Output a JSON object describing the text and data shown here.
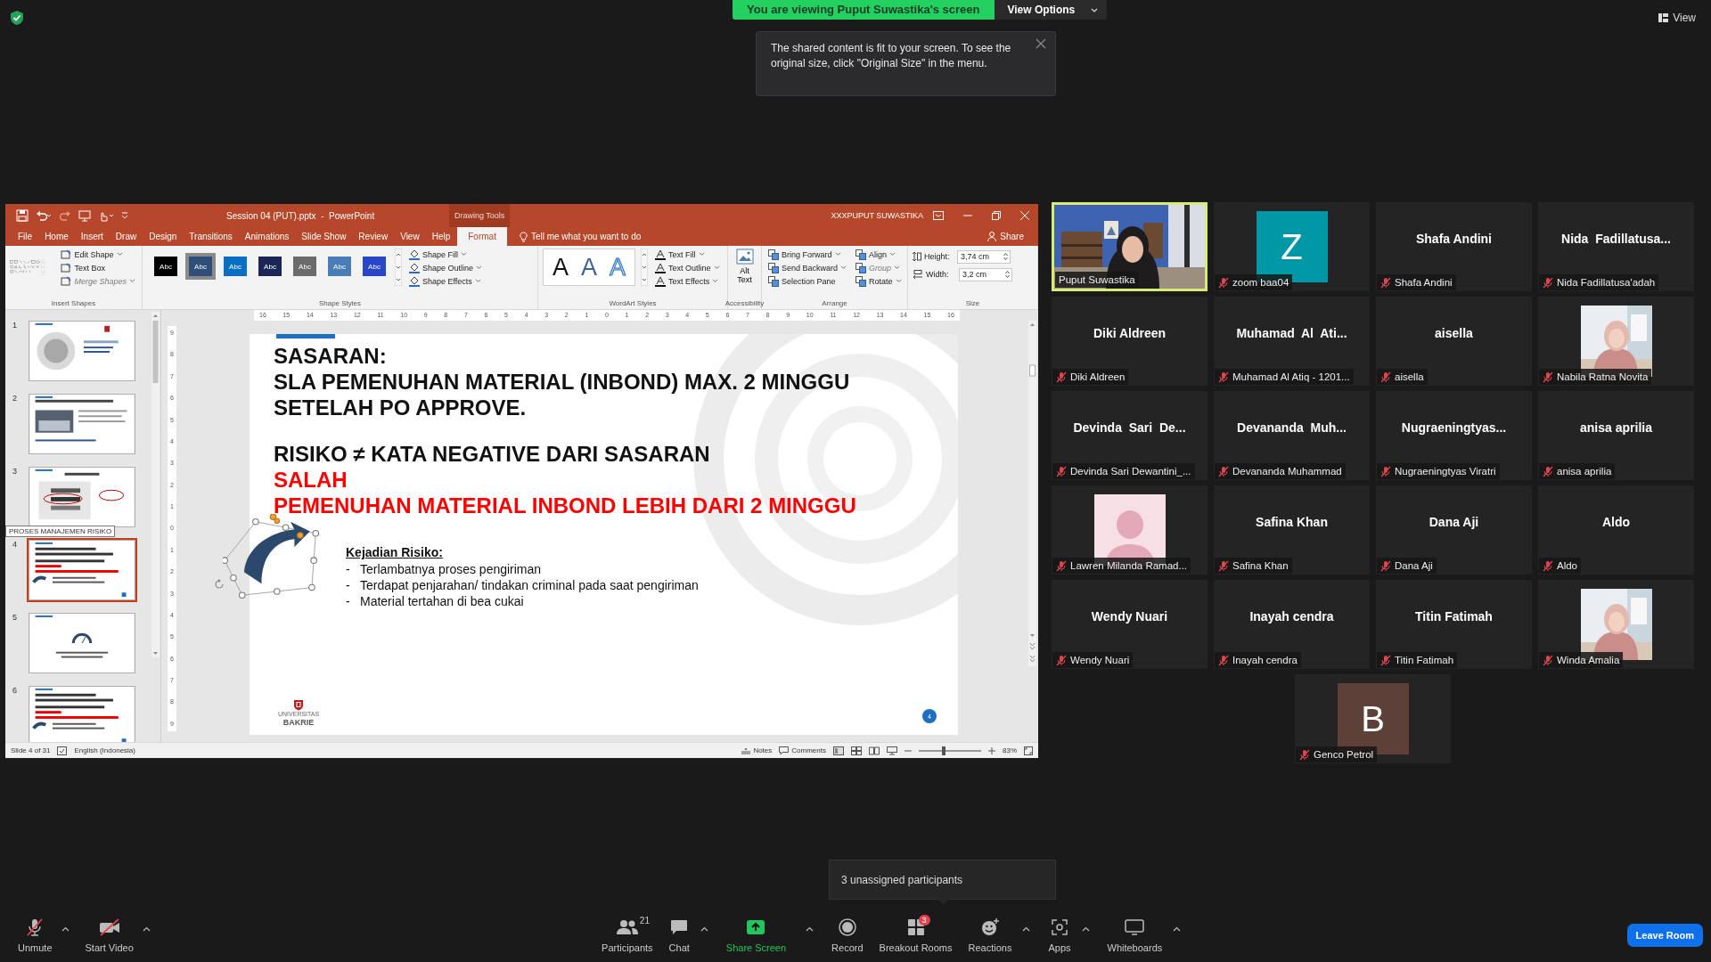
{
  "top_bar": {
    "banner": "You are viewing Puput Suwastika's screen",
    "view_options": "View Options",
    "view_button": "View"
  },
  "notice": "The shared content is fit to your screen. To see the original size, click \"Original Size\" in the menu.",
  "powerpoint": {
    "title": "Session 04 (PUT).pptx  -  PowerPoint",
    "context_label": "Drawing Tools",
    "user": "XXXPUPUT SUWASTIKA",
    "tabs": [
      {
        "label": "File",
        "selected": false
      },
      {
        "label": "Home",
        "selected": false
      },
      {
        "label": "Insert",
        "selected": false
      },
      {
        "label": "Draw",
        "selected": false
      },
      {
        "label": "Design",
        "selected": false
      },
      {
        "label": "Transitions",
        "selected": false
      },
      {
        "label": "Animations",
        "selected": false
      },
      {
        "label": "Slide Show",
        "selected": false
      },
      {
        "label": "Review",
        "selected": false
      },
      {
        "label": "View",
        "selected": false
      },
      {
        "label": "Help",
        "selected": false
      },
      {
        "label": "Format",
        "selected": true
      }
    ],
    "tell_me": "Tell me what you want to do",
    "share": "Share",
    "ribbon": [
      {
        "kind": "insert_shapes",
        "label": "Insert Shapes",
        "commands": [
          {
            "label": "Edit Shape",
            "dropdown": true,
            "disabled": false
          },
          {
            "label": "Text Box",
            "dropdown": false,
            "disabled": false
          },
          {
            "label": "Merge Shapes",
            "dropdown": true,
            "disabled": true
          }
        ]
      },
      {
        "kind": "shape_styles",
        "label": "Shape Styles",
        "styles": [
          {
            "label": "Abc",
            "color": "#000000",
            "selected": false
          },
          {
            "label": "Abc",
            "color": "#2f4e78",
            "selected": true
          },
          {
            "label": "Abc",
            "color": "#0a6fc2",
            "selected": false
          },
          {
            "label": "Abc",
            "color": "#1c2656",
            "selected": false
          },
          {
            "label": "Abc",
            "color": "#6b6b6b",
            "selected": false
          },
          {
            "label": "Abc",
            "color": "#4a7db5",
            "selected": false
          },
          {
            "label": "Abc",
            "color": "#2846c8",
            "selected": false
          }
        ],
        "commands": [
          {
            "label": "Shape Fill",
            "dropdown": true,
            "disabled": false
          },
          {
            "label": "Shape Outline",
            "dropdown": true,
            "disabled": false
          },
          {
            "label": "Shape Effects",
            "dropdown": true,
            "disabled": false
          }
        ]
      },
      {
        "kind": "wordart",
        "label": "WordArt Styles",
        "styles": [
          {
            "label": "A",
            "kind": "solid"
          },
          {
            "label": "A",
            "kind": "gradient"
          },
          {
            "label": "A",
            "kind": "outline"
          }
        ],
        "commands": [
          {
            "label": "Text Fill",
            "dropdown": true,
            "disabled": false
          },
          {
            "label": "Text Outline",
            "dropdown": true,
            "disabled": false
          },
          {
            "label": "Text Effects",
            "dropdown": true,
            "disabled": false
          }
        ]
      },
      {
        "kind": "alt_text",
        "label": "Accessibility",
        "button": "Alt Text"
      },
      {
        "kind": "arrange",
        "label": "Arrange",
        "commands": [
          {
            "label": "Bring Forward",
            "dropdown": true,
            "disabled": false
          },
          {
            "label": "Send Backward",
            "dropdown": true,
            "disabled": false
          },
          {
            "label": "Selection Pane",
            "dropdown": false,
            "disabled": false
          },
          {
            "label": "Align",
            "dropdown": true,
            "disabled": false
          },
          {
            "label": "Group",
            "dropdown": true,
            "disabled": true
          },
          {
            "label": "Rotate",
            "dropdown": true,
            "disabled": false
          }
        ]
      },
      {
        "kind": "size",
        "label": "Size",
        "fields": [
          {
            "label": "Height:",
            "value": "3,74 cm"
          },
          {
            "label": "Width:",
            "value": "3,2 cm"
          }
        ]
      }
    ],
    "ruler": {
      "horizontal": [
        "16",
        "15",
        "14",
        "13",
        "12",
        "11",
        "10",
        "9",
        "8",
        "7",
        "6",
        "5",
        "4",
        "3",
        "2",
        "1",
        "0",
        "1",
        "2",
        "3",
        "4",
        "5",
        "6",
        "7",
        "8",
        "9",
        "10",
        "11",
        "12",
        "13",
        "14",
        "15",
        "16"
      ],
      "vertical": [
        "9",
        "8",
        "7",
        "6",
        "5",
        "4",
        "3",
        "2",
        "1",
        "0",
        "1",
        "2",
        "3",
        "4",
        "5",
        "6",
        "7",
        "8",
        "9"
      ]
    },
    "thumbnails": [
      {
        "number": "1",
        "kind": "cover",
        "selected": false
      },
      {
        "number": "2",
        "selected": false
      },
      {
        "number": "3",
        "kind": "diagram",
        "selected": false
      },
      {
        "number": "4",
        "kind": "text",
        "selected": true
      },
      {
        "number": "5",
        "kind": "gauge",
        "selected": false
      },
      {
        "number": "6",
        "kind": "text",
        "selected": false
      }
    ],
    "thumbnail_tooltip": "PROSES MANAJEMEN RISIKO",
    "slide": {
      "paragraphs": [
        {
          "lines": [
            {
              "text": "SASARAN:",
              "color": "#111111"
            },
            {
              "text": "SLA PEMENUHAN MATERIAL (INBOND) MAX. 2 MINGGU",
              "color": "#111111"
            },
            {
              "text": "SETELAH PO APPROVE.",
              "color": "#111111"
            }
          ]
        },
        {
          "lines": [
            {
              "text": "RISIKO ≠ KATA NEGATIVE DARI SASARAN",
              "color": "#111111"
            },
            {
              "text": "SALAH",
              "color": "#ff0000"
            },
            {
              "text": "PEMENUHAN MATERIAL INBOND LEBIH DARI 2 MINGGU",
              "color": "#ff0000"
            }
          ]
        }
      ],
      "risk_heading": "Kejadian Risiko:",
      "risks": [
        {
          "marker": "-",
          "text": "Terlambatnya proses pengiriman"
        },
        {
          "marker": "-",
          "text": "Terdapat penjarahan/ tindakan criminal pada saat pengiriman"
        },
        {
          "marker": "-",
          "text": "Material tertahan di bea cukai"
        }
      ],
      "logo": {
        "small": "UNIVERSITAS",
        "name": "BAKRIE"
      },
      "page_number": "4"
    },
    "status": {
      "slide": "Slide 4 of 31",
      "language": "English (Indonesia)",
      "notes": "Notes",
      "comments": "Comments",
      "zoom": "83%",
      "zoom_slider": {
        "level": 0.4
      }
    }
  },
  "participants": [
    {
      "kind": "video",
      "name": "Puput Suwastika",
      "muted": false,
      "speaking": true
    },
    {
      "kind": "avatar",
      "letter": "Z",
      "color": "#0097a7",
      "name": "zoom baa04",
      "muted": true,
      "speaking": false
    },
    {
      "kind": "name",
      "title": "Shafa Andini",
      "name": "Shafa Andini",
      "muted": true,
      "speaking": false
    },
    {
      "kind": "name",
      "title": "Nida  Fadillatusa...",
      "name": "Nida Fadillatusa'adah",
      "muted": true,
      "speaking": false
    },
    {
      "kind": "name",
      "title": "Diki Aldreen",
      "name": "Diki Aldreen",
      "muted": true,
      "speaking": false
    },
    {
      "kind": "name",
      "title": "Muhamad  Al  Ati...",
      "name": "Muhamad Al Atiq - 1201...",
      "muted": true,
      "speaking": false
    },
    {
      "kind": "name",
      "title": "aisella",
      "name": "aisella",
      "muted": true,
      "speaking": false
    },
    {
      "name": "Nabila Ratna Novita",
      "muted": true,
      "speaking": false
    },
    {
      "kind": "name",
      "title": "Devinda  Sari  De...",
      "name": "Devinda Sari Dewantini_...",
      "muted": true,
      "speaking": false
    },
    {
      "kind": "name",
      "title": "Devananda  Muh...",
      "name": "Devananda Muhammad",
      "muted": true,
      "speaking": false
    },
    {
      "kind": "name",
      "title": "Nugraeningtyas...",
      "name": "Nugraeningtyas Viratri",
      "muted": true,
      "speaking": false
    },
    {
      "kind": "name",
      "title": "anisa aprilia",
      "name": "anisa aprilia",
      "muted": true,
      "speaking": false
    },
    {
      "kind": "default_avatar",
      "name": "Lawren Milanda Ramad...",
      "muted": true,
      "speaking": false
    },
    {
      "kind": "name",
      "title": "Safina Khan",
      "name": "Safina Khan",
      "muted": true,
      "speaking": false
    },
    {
      "kind": "name",
      "title": "Dana Aji",
      "name": "Dana Aji",
      "muted": true,
      "speaking": false
    },
    {
      "kind": "name",
      "title": "Aldo",
      "name": "Aldo",
      "muted": true,
      "speaking": false
    },
    {
      "kind": "name",
      "title": "Wendy Nuari",
      "name": "Wendy Nuari",
      "muted": true,
      "speaking": false
    },
    {
      "kind": "name",
      "title": "Inayah cendra",
      "name": "Inayah cendra",
      "muted": true,
      "speaking": false
    },
    {
      "kind": "name",
      "title": "Titin Fatimah",
      "name": "Titin Fatimah",
      "muted": true,
      "speaking": false
    },
    {
      "name": "Winda Amalia",
      "muted": true,
      "speaking": false
    },
    {
      "kind": "avatar",
      "letter": "B",
      "color": "#5d4037",
      "name": "Genco Petrol",
      "muted": true,
      "speaking": false
    }
  ],
  "unassigned_tooltip": "3 unassigned participants",
  "toolbar": {
    "left_buttons": [
      {
        "kind": "mic",
        "label": "Unmute",
        "off": true,
        "caret": true
      },
      {
        "kind": "video",
        "label": "Start Video",
        "off": true,
        "caret": true
      }
    ],
    "center_buttons": [
      {
        "kind": "participants",
        "label": "Participants",
        "count": "21",
        "caret": false
      },
      {
        "kind": "chat",
        "label": "Chat",
        "caret": true
      },
      {
        "kind": "share",
        "label": "Share Screen",
        "caret": true
      },
      {
        "kind": "record",
        "label": "Record",
        "caret": false
      },
      {
        "kind": "breakout",
        "label": "Breakout Rooms",
        "badge": "3",
        "caret": false
      },
      {
        "kind": "reactions",
        "label": "Reactions",
        "caret": true
      },
      {
        "kind": "apps",
        "label": "Apps",
        "caret": true
      },
      {
        "kind": "whiteboards",
        "label": "Whiteboards",
        "caret": true
      }
    ],
    "leave": "Leave Room"
  }
}
